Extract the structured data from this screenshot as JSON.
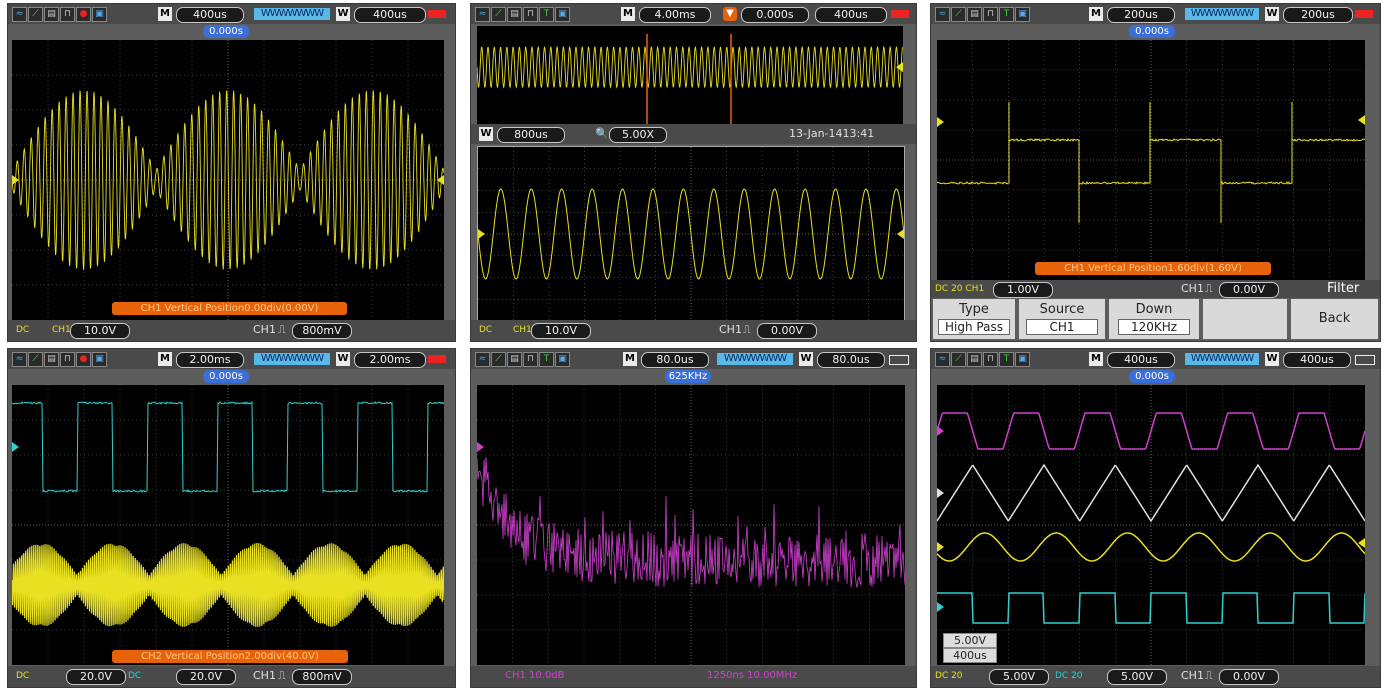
{
  "panels": [
    {
      "id": "p1",
      "top": {
        "m_label": "M",
        "time_base": "400us",
        "w_label": "W",
        "window": "400us",
        "trigger_pos": "0.000s"
      },
      "bottom": {
        "coupling": "DC",
        "ch1_scale": "10.0V",
        "trig_ch": "CH1",
        "trig_level": "800mV"
      },
      "message": "CH1 Vertical Position0.00div(0.00V)"
    },
    {
      "id": "p2",
      "top": {
        "m_label": "M",
        "time_base": "4.00ms",
        "trig_time": "0.000s",
        "window": "400us"
      },
      "zoom_bar": {
        "w_label": "W",
        "window": "800us",
        "zoom": "5.00X",
        "timestamp": "13-Jan-1413:41"
      },
      "bottom": {
        "coupling": "DC",
        "ch1_scale": "10.0V",
        "trig_ch": "CH1",
        "trig_level": "0.00V"
      }
    },
    {
      "id": "p3",
      "top": {
        "m_label": "M",
        "time_base": "200us",
        "w_label": "W",
        "window": "200us",
        "trigger_pos": "0.000s"
      },
      "message": "CH1 Vertical Position1.60div(1.60V)",
      "bottom": {
        "ch1_scale": "1.00V",
        "trig_ch": "CH1",
        "trig_level": "0.00V"
      },
      "menu": {
        "title": "Filter",
        "items": [
          {
            "label": "Type",
            "value": "High Pass"
          },
          {
            "label": "Source",
            "value": "CH1"
          },
          {
            "label": "Down",
            "value": "120KHz"
          },
          {
            "label": "",
            "value": ""
          },
          {
            "label": "Back",
            "value": ""
          }
        ]
      }
    },
    {
      "id": "p4",
      "top": {
        "m_label": "M",
        "time_base": "2.00ms",
        "w_label": "W",
        "window": "2.00ms",
        "trigger_pos": "0.000s"
      },
      "message": "CH2 Vertical Position2.00div(40.0V)",
      "bottom": {
        "ch1_scale": "20.0V",
        "ch2_scale": "20.0V",
        "trig_ch": "CH1",
        "trig_level": "800mV"
      }
    },
    {
      "id": "p5",
      "top": {
        "m_label": "M",
        "time_base": "80.0us",
        "w_label": "W",
        "window": "80.0us",
        "freq": "625KHz"
      },
      "bottom": {
        "left": "CH1 10.0dB",
        "right": "1250ns 10.00MHz"
      }
    },
    {
      "id": "p6",
      "top": {
        "m_label": "M",
        "time_base": "400us",
        "w_label": "W",
        "window": "400us",
        "trigger_pos": "0.000s"
      },
      "cursor": {
        "v": "5.00V",
        "t": "400us"
      },
      "bottom": {
        "ch_a_scale": "5.00V",
        "ch_b_scale": "5.00V",
        "trig_ch": "CH1",
        "trig_level": "0.00V"
      }
    }
  ],
  "colors": {
    "ch1": "#e8e020",
    "ch2": "#30d0d0",
    "math": "#d040d0",
    "ref": "#e0e0e0",
    "grid": "#7a7a7a",
    "orange": "#e8620a"
  },
  "icons": [
    "waveform-icon",
    "line-icon",
    "save-icon",
    "pulse-icon",
    "record-icon",
    "disk-icon"
  ]
}
